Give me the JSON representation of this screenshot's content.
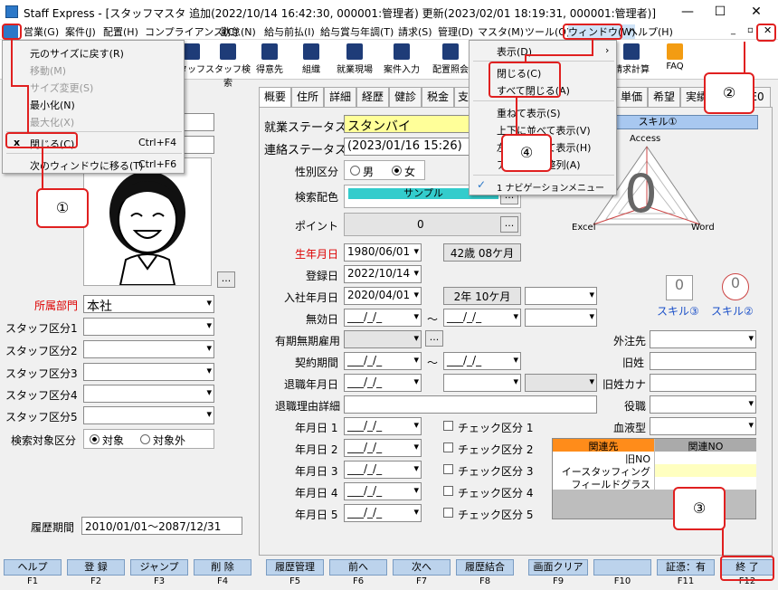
{
  "titlebar": {
    "title": "Staff Express - [スタッフマスタ  追加(2022/10/14 16:42:30, 000001:管理者) 更新(2023/02/01 18:19:31, 000001:管理者)]",
    "min": "—",
    "max": "☐",
    "close": "✕"
  },
  "menu": [
    "営業(G)",
    "案件(J)",
    "配置(H)",
    "コンプライアンス(C)",
    "勤怠(N)",
    "給与前払(I)",
    "給与賞与年調(T)",
    "請求(S)",
    "管理(D)",
    "マスタ(M)",
    "ツール(O)",
    "ウィンドウ(W)",
    "ヘルプ(H)"
  ],
  "toolbar": [
    "タッフ",
    "スタッフ検索",
    "得意先",
    "組織",
    "就業現場",
    "案件入力",
    "配置照会",
    "請求計算",
    "FAQ"
  ],
  "sysmenu": {
    "items": [
      "元のサイズに戻す(R)",
      "移動(M)",
      "サイズ変更(S)",
      "最小化(N)",
      "最大化(X)",
      "閉じる(C)",
      "次のウィンドウに移る(T)"
    ],
    "close_shortcut": "Ctrl+F4",
    "next_shortcut": "Ctrl+F6"
  },
  "winmenu": {
    "items": [
      "表示(D)",
      "閉じる(C)",
      "すべて閉じる(A)",
      "重ねて表示(S)",
      "上下に並べて表示(V)",
      "左右に並べて表示(H)",
      "アイコンの整列(A)",
      "1 ナビゲーションメニュー"
    ]
  },
  "tabs": [
    "概要",
    "住所",
    "詳細",
    "経歴",
    "健診",
    "税金",
    "支",
    "単価",
    "希望",
    "実績",
    "E0"
  ],
  "left": {
    "dept_label": "所属部門",
    "dept": "本社",
    "staff_kbn": [
      "スタッフ区分1",
      "スタッフ区分2",
      "スタッフ区分3",
      "スタッフ区分4",
      "スタッフ区分5"
    ],
    "search_label": "検索対象区分",
    "search_on": "対象",
    "search_off": "対象外",
    "period_label": "履歴期間",
    "period": "2010/01/01～2087/12/31",
    "photo_btn": "..."
  },
  "form": {
    "work_status_label": "就業ステータス",
    "work_status": "スタンバイ",
    "contact_status_label": "連絡ステータス",
    "contact_status": "(2023/01/16 15:26)",
    "gender_label": "性別区分",
    "male": "男",
    "female": "女",
    "color_label": "検索配色",
    "color_value": "サンプル",
    "point_label": "ポイント",
    "point": "0",
    "birth_label": "生年月日",
    "birth": "1980/06/01",
    "age": "42歳 08ケ月",
    "reg_label": "登録日",
    "reg": "2022/10/14",
    "join_label": "入社年月日",
    "join": "2020/04/01",
    "tenure": "2年 10ケ月",
    "invalid_label": "無効日",
    "fixed_label": "有期無期雇用",
    "contract_label": "契約期間",
    "retire_label": "退職年月日",
    "retire_reason_label": "退職理由詳細",
    "date_labels": [
      "年月日 1",
      "年月日 2",
      "年月日 3",
      "年月日 4",
      "年月日 5"
    ],
    "check_labels": [
      "チェック区分 1",
      "チェック区分 2",
      "チェック区分 3",
      "チェック区分 4",
      "チェック区分 5"
    ],
    "blank_date": "___/_/_",
    "tilde": "〜",
    "outsource_label": "外注先",
    "old_name_label": "旧姓",
    "old_kana_label": "旧姓カナ",
    "role_label": "役職",
    "blood_label": "血液型"
  },
  "skill": {
    "header": "スキル①",
    "access": "Access",
    "excel": "Excel",
    "word": "Word",
    "value": "0",
    "s3": "スキル③",
    "s2": "スキル②",
    "s_value": "0"
  },
  "related": {
    "h1": "関連先",
    "h2": "関連NO",
    "rows": [
      "旧NO",
      "イースタッフィング",
      "フィールドグラス"
    ]
  },
  "fkeys": [
    {
      "label": "ヘルプ",
      "key": "F1"
    },
    {
      "label": "登 録",
      "key": "F2"
    },
    {
      "label": "ジャンプ",
      "key": "F3"
    },
    {
      "label": "削 除",
      "key": "F4"
    },
    {
      "label": "履歴管理",
      "key": "F5"
    },
    {
      "label": "前へ",
      "key": "F6"
    },
    {
      "label": "次へ",
      "key": "F7"
    },
    {
      "label": "履歴結合",
      "key": "F8"
    },
    {
      "label": "画面クリア",
      "key": "F9"
    },
    {
      "label": "",
      "key": "F10"
    },
    {
      "label": "証憑：有",
      "key": "F11"
    },
    {
      "label": "終 了",
      "key": "F12"
    }
  ],
  "callouts": [
    "①",
    "②",
    "③",
    "④"
  ],
  "colors": {
    "accent_red": "#e02020",
    "fkey_blue": "#bcd3ec",
    "work_yellow": "#ffff99",
    "sample_cyan": "#33cccc",
    "rel_header": "#ff8c1a"
  }
}
